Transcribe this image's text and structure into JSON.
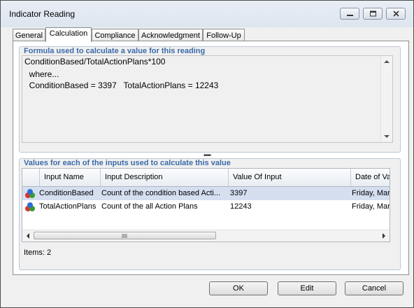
{
  "window": {
    "title": "Indicator Reading"
  },
  "tabs": [
    {
      "label": "General"
    },
    {
      "label": "Calculation"
    },
    {
      "label": "Compliance"
    },
    {
      "label": "Acknowledgment"
    },
    {
      "label": "Follow-Up"
    }
  ],
  "formula_group": {
    "title": "Formula used to calculate a value for this reading",
    "lines": [
      "ConditionBased/TotalActionPlans*100",
      "  where...",
      "  ConditionBased = 3397   TotalActionPlans = 12243"
    ]
  },
  "inputs_group": {
    "title": "Values for each of the inputs used to calculate this value",
    "columns": [
      "Input Name",
      "Input Description",
      "Value Of Input",
      "Date of Va"
    ],
    "rows": [
      {
        "name": "ConditionBased",
        "description": "Count of the condition based Acti...",
        "value": "3397",
        "date": "Friday, Marc"
      },
      {
        "name": "TotalActionPlans",
        "description": "Count of the all Action Plans",
        "value": "12243",
        "date": "Friday, Marc"
      }
    ],
    "items_label": "Items: 2"
  },
  "buttons": {
    "ok": "OK",
    "edit": "Edit",
    "cancel": "Cancel"
  },
  "icons": {
    "row_icon": "colored-balls-icon",
    "minimize": "minimize-icon",
    "maximize": "maximize-icon",
    "close": "close-icon"
  }
}
